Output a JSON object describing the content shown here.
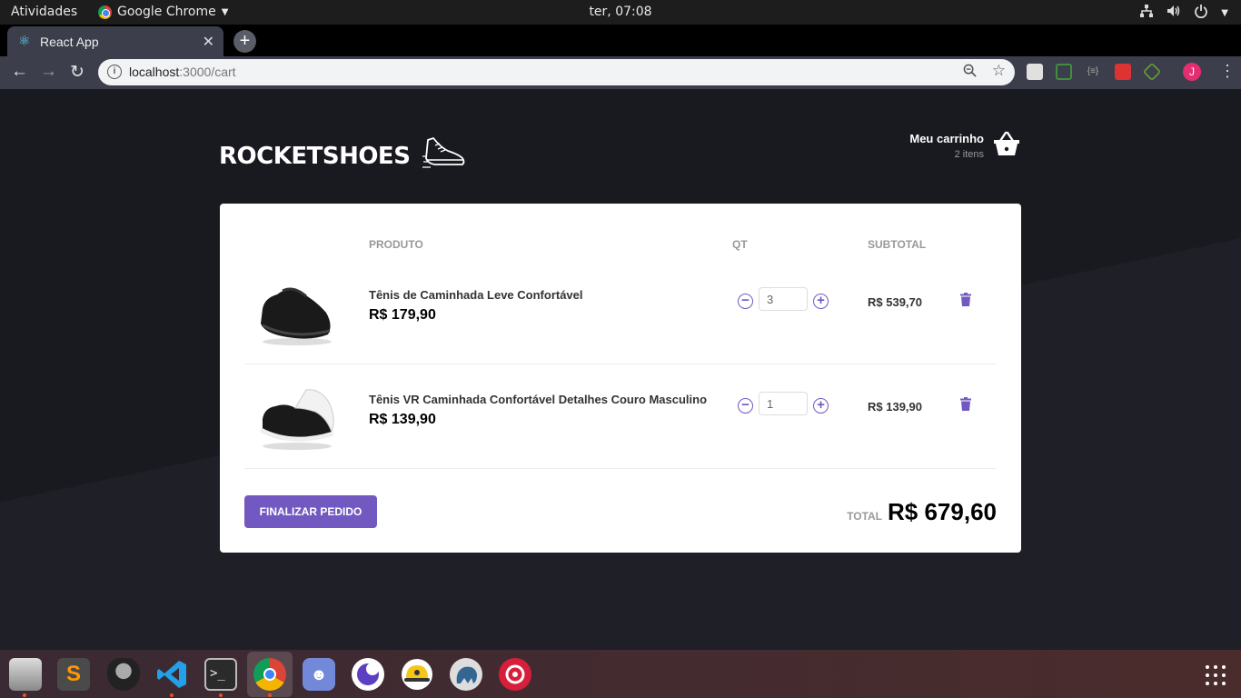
{
  "system": {
    "activities": "Atividades",
    "app_name": "Google Chrome",
    "clock": "ter, 07:08"
  },
  "browser": {
    "tab_title": "React App",
    "url_host": "localhost",
    "url_path": ":3000/cart",
    "profile_initial": "J"
  },
  "header": {
    "brand": "ROCKETSHOES",
    "cart_title": "Meu carrinho",
    "cart_count": "2 itens"
  },
  "table": {
    "col_product": "PRODUTO",
    "col_qty": "QT",
    "col_subtotal": "SUBTOTAL"
  },
  "items": [
    {
      "name": "Tênis de Caminhada Leve Confortável",
      "price": "R$ 179,90",
      "quantity": "3",
      "subtotal": "R$ 539,70"
    },
    {
      "name": "Tênis VR Caminhada Confortável Detalhes Couro Masculino",
      "price": "R$ 139,90",
      "quantity": "1",
      "subtotal": "R$ 139,90"
    }
  ],
  "footer": {
    "checkout_label": "FINALIZAR PEDIDO",
    "total_label": "TOTAL",
    "total_value": "R$ 679,60"
  },
  "colors": {
    "accent": "#7159c1",
    "background": "#191920"
  }
}
